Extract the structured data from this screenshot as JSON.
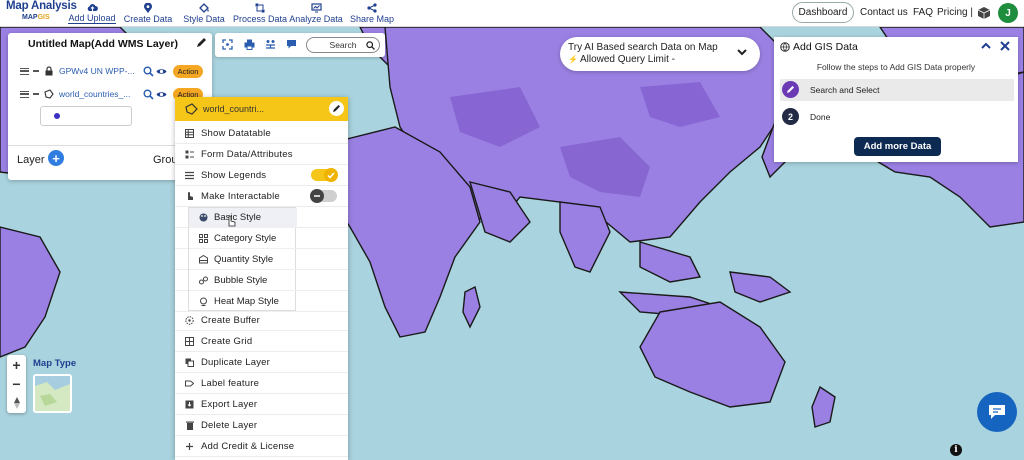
{
  "brand": {
    "name": "Map Analysis",
    "sub_left": "MAP",
    "sub_right": "GIS"
  },
  "nav": [
    {
      "label": "Add Upload",
      "icon": "cloud-upload-icon",
      "active": true
    },
    {
      "label": "Create Data",
      "icon": "map-pin-icon"
    },
    {
      "label": "Style Data",
      "icon": "paint-bucket-icon"
    },
    {
      "label": "Process Data",
      "icon": "process-icon"
    },
    {
      "label": "Analyze Data",
      "icon": "analyze-icon"
    },
    {
      "label": "Share Map",
      "icon": "share-icon"
    }
  ],
  "header_right": {
    "dashboard": "Dashboard",
    "contact": "Contact us",
    "faq": "FAQ",
    "pricing": "Pricing |",
    "avatar": "J"
  },
  "layer_panel": {
    "title": "Untitled Map(Add WMS Layer)",
    "layers": [
      {
        "name": "GPWv4 UN WPP-...",
        "action": "Action"
      },
      {
        "name": "world_countries_...",
        "action": "Action"
      }
    ],
    "layer_label": "Layer",
    "add_symbol": "+",
    "group_label": "Group"
  },
  "map_toolbar": {
    "search": "Search"
  },
  "context_menu": {
    "header": "world_countri...",
    "items": [
      {
        "label": "Show Datatable",
        "icon": "table-icon"
      },
      {
        "label": "Form Data/Attributes",
        "icon": "form-icon"
      },
      {
        "label": "Show Legends",
        "icon": "list-icon",
        "toggle": "on"
      },
      {
        "label": "Make Interactable",
        "icon": "hand-pointer-icon",
        "toggle": "off"
      },
      {
        "label": "Create Buffer",
        "icon": "buffer-icon"
      },
      {
        "label": "Create Grid",
        "icon": "grid-icon"
      },
      {
        "label": "Duplicate Layer",
        "icon": "duplicate-icon"
      },
      {
        "label": "Label feature",
        "icon": "label-icon"
      },
      {
        "label": "Export Layer",
        "icon": "export-icon"
      },
      {
        "label": "Delete Layer",
        "icon": "trash-icon"
      },
      {
        "label": "Add Credit & License",
        "icon": "plus-icon"
      }
    ]
  },
  "style_submenu": [
    {
      "label": "Basic Style",
      "icon": "palette-icon",
      "highlight": true
    },
    {
      "label": "Category Style",
      "icon": "category-icon"
    },
    {
      "label": "Quantity Style",
      "icon": "quantity-icon"
    },
    {
      "label": "Bubble Style",
      "icon": "bubble-icon"
    },
    {
      "label": "Heat Map Style",
      "icon": "heatmap-icon"
    }
  ],
  "ai_search": {
    "line1": "Try AI Based search Data on Map",
    "line2": "Allowed Query Limit -"
  },
  "gis_panel": {
    "title": "Add GIS Data",
    "subtitle": "Follow the steps to Add GIS Data properly",
    "steps": [
      {
        "num": "",
        "label": "Search and Select",
        "selected": true
      },
      {
        "num": "2",
        "label": "Done"
      }
    ],
    "button": "Add more Data"
  },
  "zoom": {
    "in": "+",
    "out": "−"
  },
  "map_type": {
    "label": "Map Type"
  },
  "info": "i",
  "colors": {
    "brand_blue": "#1f3f8f",
    "action_orange": "#f5a623",
    "menu_yellow": "#f5c518",
    "step_purple": "#6d3ab5",
    "button_navy": "#0d2a52",
    "ocean": "#a9d3de",
    "land": "#9b7ee6"
  }
}
